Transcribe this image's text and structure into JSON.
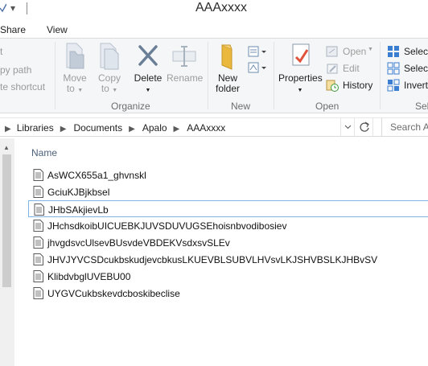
{
  "window": {
    "title": "AAAxxxx"
  },
  "ribbon_tabs": [
    {
      "label": "Share"
    },
    {
      "label": "View"
    }
  ],
  "clipboard_partial": {
    "items": [
      "t",
      "py path",
      "te shortcut"
    ]
  },
  "organize": {
    "group_label": "Organize",
    "move_to": {
      "line1": "Move",
      "line2": "to"
    },
    "copy_to": {
      "line1": "Copy",
      "line2": "to"
    },
    "delete": {
      "label": "Delete"
    },
    "rename": {
      "label": "Rename"
    }
  },
  "new_group": {
    "group_label": "New",
    "new_folder": {
      "line1": "New",
      "line2": "folder"
    }
  },
  "open_group": {
    "group_label": "Open",
    "properties": {
      "label": "Properties"
    },
    "open": {
      "label": "Open"
    },
    "edit": {
      "label": "Edit"
    },
    "history": {
      "label": "History"
    }
  },
  "select_group": {
    "group_label": "Sel",
    "select_all": {
      "label": "Select"
    },
    "select_none": {
      "label": "Select"
    },
    "invert": {
      "label": "Invert"
    }
  },
  "address": {
    "crumbs": [
      "Libraries",
      "Documents",
      "Apalo",
      "AAAxxxx"
    ],
    "search_placeholder": "Search A"
  },
  "file_list": {
    "column_name": "Name",
    "files": [
      {
        "name": "AsWCX655a1_ghvnskl"
      },
      {
        "name": "GciuKJBjkbsel"
      },
      {
        "name": "JHbSAkjievLb",
        "selected": true
      },
      {
        "name": "JHchsdkoibUICUEBKJUVSDUVUGSEhoisnbvodibosiev"
      },
      {
        "name": "jhvgdsvcUlsevBUsvdeVBDEKVsdxsvSLEv"
      },
      {
        "name": "JHVJYVCSDcukbskudjevcbkusLKUEVBLSUBVLHVsvLKJSHVBSLKJHBvSV"
      },
      {
        "name": "KlibdvbglUVEBU00"
      },
      {
        "name": "UYGVCukbskevdcboskibeclise"
      }
    ]
  },
  "colors": {
    "ribbon_bg": "#f5f6f7",
    "selection_border": "#7fb5e6",
    "column_header_text": "#4c607a",
    "disabled_text": "#9d9d9d"
  }
}
